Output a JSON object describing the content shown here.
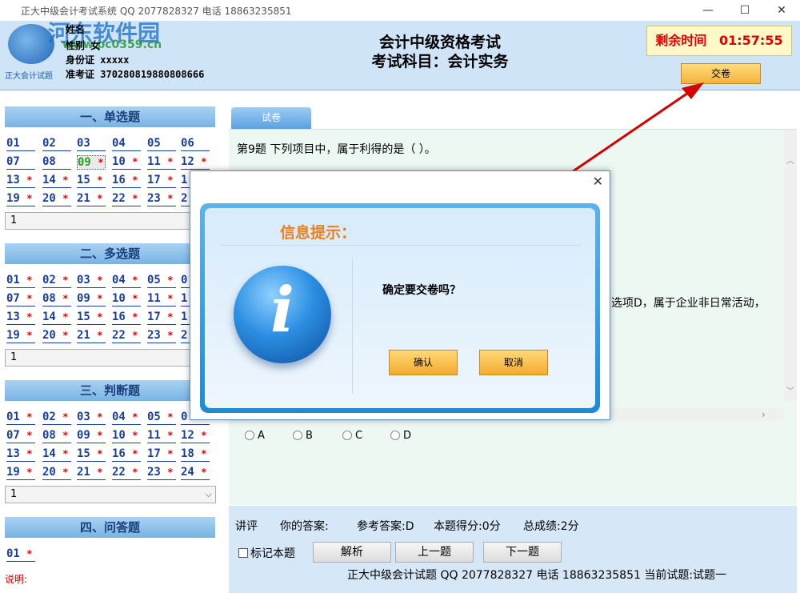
{
  "window": {
    "title": "正大中级会计考试系统 QQ 2077828327 电话 18863235851",
    "minimize": "—",
    "maximize": "☐",
    "close": "✕"
  },
  "watermark": {
    "text": "河东软件园",
    "url": "www.pc0359.cn"
  },
  "logo": {
    "label": "正大会计试题"
  },
  "candidate": {
    "name_label": "姓名",
    "gender_label": "性别",
    "gender": "女",
    "id_label": "身份证",
    "id": "xxxxx",
    "ticket_label": "准考证",
    "ticket": "370280819880808666"
  },
  "exam": {
    "title": "会计中级资格考试",
    "subject": "考试科目：会计实务"
  },
  "timer": {
    "label": "剩余时间",
    "value": "01:57:55"
  },
  "submit_label": "交卷",
  "sections": [
    {
      "title": "一、单选题",
      "rows": [
        [
          "01",
          "02",
          "03",
          "04",
          "05",
          "06"
        ],
        [
          "07",
          "08",
          "09 *",
          "10 *",
          "11 *",
          "12 *"
        ],
        [
          "13 *",
          "14 *",
          "15 *",
          "16 *",
          "17 *",
          "1"
        ],
        [
          "19 *",
          "20 *",
          "21 *",
          "22 *",
          "23 *",
          "2"
        ]
      ],
      "page": "1"
    },
    {
      "title": "二、多选题",
      "rows": [
        [
          "01 *",
          "02 *",
          "03 *",
          "04 *",
          "05 *",
          "0"
        ],
        [
          "07 *",
          "08 *",
          "09 *",
          "10 *",
          "11 *",
          "1"
        ],
        [
          "13 *",
          "14 *",
          "15 *",
          "16 *",
          "17 *",
          "1"
        ],
        [
          "19 *",
          "20 *",
          "21 *",
          "22 *",
          "23 *",
          "2"
        ]
      ],
      "page": "1"
    },
    {
      "title": "三、判断题",
      "rows": [
        [
          "01 *",
          "02 *",
          "03 *",
          "04 *",
          "05 *",
          "0"
        ],
        [
          "07 *",
          "08 *",
          "09 *",
          "10 *",
          "11 *",
          "12 *"
        ],
        [
          "13 *",
          "14 *",
          "15 *",
          "16 *",
          "17 *",
          "18 *"
        ],
        [
          "19 *",
          "20 *",
          "21 *",
          "22 *",
          "23 *",
          "24 *"
        ]
      ],
      "page": "1"
    },
    {
      "title": "四、问答题",
      "rows": [
        [
          "01 *"
        ]
      ]
    }
  ],
  "note": "说明:",
  "tab_label": "试卷",
  "question": {
    "text": "第9题  下列项目中，属于利得的是（   ）。",
    "explain_fragment": "选项D，属于企业非日常活动，",
    "options": [
      "A",
      "B",
      "C",
      "D"
    ]
  },
  "bottom": {
    "lecture": "讲评",
    "your_answer": "你的答案:",
    "ref_answer": "参考答案:D",
    "score": "本题得分:0分",
    "total": "总成绩:2分",
    "mark": "标记本题",
    "analyze": "解析",
    "prev": "上一题",
    "next": "下一题",
    "footer": "正大中级会计试题    QQ 2077828327    电话 18863235851 当前试题:试题一"
  },
  "dialog": {
    "title": "信息提示：",
    "message": "确定要交卷吗？",
    "confirm": "确认",
    "cancel": "取消",
    "close": "✕"
  }
}
